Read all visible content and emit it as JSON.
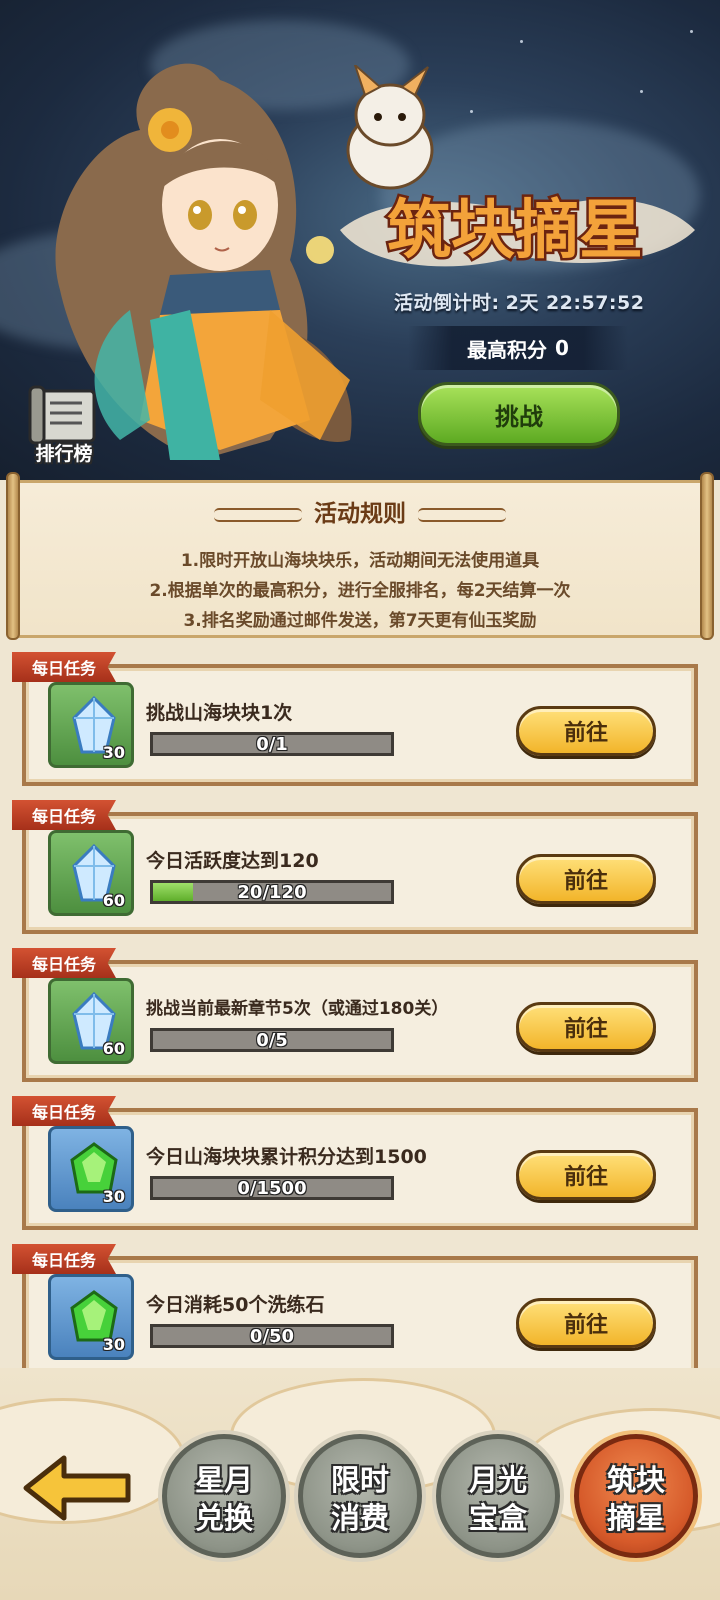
{
  "event": {
    "title": "筑块摘星",
    "countdown_label": "活动倒计时:",
    "countdown_value": "2天 22:57:52",
    "best_score_label": "最高积分",
    "best_score_value": "0",
    "challenge_label": "挑战",
    "ranking_label": "排行榜"
  },
  "rules": {
    "title": "活动规则",
    "lines": [
      "1.限时开放山海块块乐，活动期间无法使用道具",
      "2.根据单次的最高积分，进行全服排名，每2天结算一次",
      "3.排名奖励通过邮件发送，第7天更有仙玉奖励"
    ]
  },
  "tasks": [
    {
      "tag": "每日任务",
      "name": "挑战山海块块1次",
      "reward_icon": "blue-crystal-icon",
      "reward_qty": "30",
      "progress_text": "0/1",
      "progress": 0.0,
      "button": "前往"
    },
    {
      "tag": "每日任务",
      "name": "今日活跃度达到120",
      "reward_icon": "blue-crystal-icon",
      "reward_qty": "60",
      "progress_text": "20/120",
      "progress": 0.1667,
      "button": "前往"
    },
    {
      "tag": "每日任务",
      "name": "挑战当前最新章节5次（或通过180关）",
      "reward_icon": "blue-crystal-icon",
      "reward_qty": "60",
      "progress_text": "0/5",
      "progress": 0.0,
      "button": "前往"
    },
    {
      "tag": "每日任务",
      "name": "今日山海块块累计积分达到1500",
      "reward_icon": "green-gem-icon",
      "reward_qty": "30",
      "progress_text": "0/1500",
      "progress": 0.0,
      "button": "前往"
    },
    {
      "tag": "每日任务",
      "name": "今日消耗50个洗练石",
      "reward_icon": "green-gem-icon",
      "reward_qty": "30",
      "progress_text": "0/50",
      "progress": 0.0,
      "button": "前往"
    }
  ],
  "nav": {
    "back_icon": "back-arrow-icon",
    "items": [
      {
        "line1": "星月",
        "line2": "兑换",
        "active": false
      },
      {
        "line1": "限时",
        "line2": "消费",
        "active": false
      },
      {
        "line1": "月光",
        "line2": "宝盒",
        "active": false
      },
      {
        "line1": "筑块",
        "line2": "摘星",
        "active": true
      }
    ]
  },
  "colors": {
    "accent_green": "#5daa22",
    "button_yellow": "#f2b52a",
    "ribbon_red": "#b63a20",
    "active_orange": "#d65a2a"
  }
}
